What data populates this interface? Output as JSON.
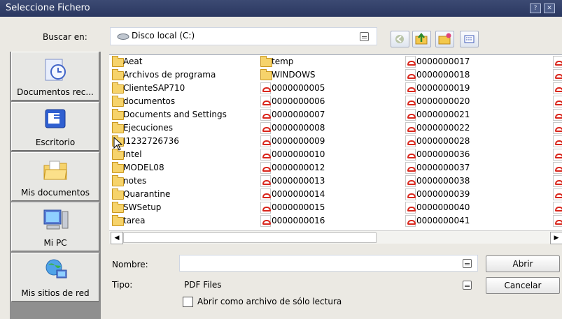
{
  "title": "Seleccione Fichero",
  "title_buttons": [
    "?",
    "✕"
  ],
  "lookin": {
    "label": "Buscar en:",
    "value": "Disco local (C:)"
  },
  "places": [
    {
      "label": "Documentos rec..."
    },
    {
      "label": "Escritorio"
    },
    {
      "label": "Mis documentos"
    },
    {
      "label": "Mi PC"
    },
    {
      "label": "Mis sitios de red"
    }
  ],
  "files": {
    "col1": [
      "Aeat",
      "Archivos de programa",
      "ClienteSAP710",
      "documentos",
      "Documents and Settings",
      "Ejecuciones",
      "I1232726736",
      "Intel",
      "MODEL08",
      "notes",
      "Quarantine",
      "SWSetup",
      "tarea"
    ],
    "col2": [
      "temp",
      "WINDOWS",
      "0000000005",
      "0000000006",
      "0000000007",
      "0000000008",
      "0000000009",
      "0000000010",
      "0000000012",
      "0000000013",
      "0000000014",
      "0000000015",
      "0000000016"
    ],
    "col3": [
      "0000000017",
      "0000000018",
      "0000000019",
      "0000000020",
      "0000000021",
      "0000000022",
      "0000000028",
      "0000000036",
      "0000000037",
      "0000000038",
      "0000000039",
      "0000000040",
      "0000000041"
    ]
  },
  "form": {
    "name_label": "Nombre:",
    "name_value": "",
    "type_label": "Tipo:",
    "type_value": "PDF Files",
    "readonly_label": "Abrir como archivo de sólo lectura"
  },
  "buttons": {
    "open": "Abrir",
    "cancel": "Cancelar"
  }
}
